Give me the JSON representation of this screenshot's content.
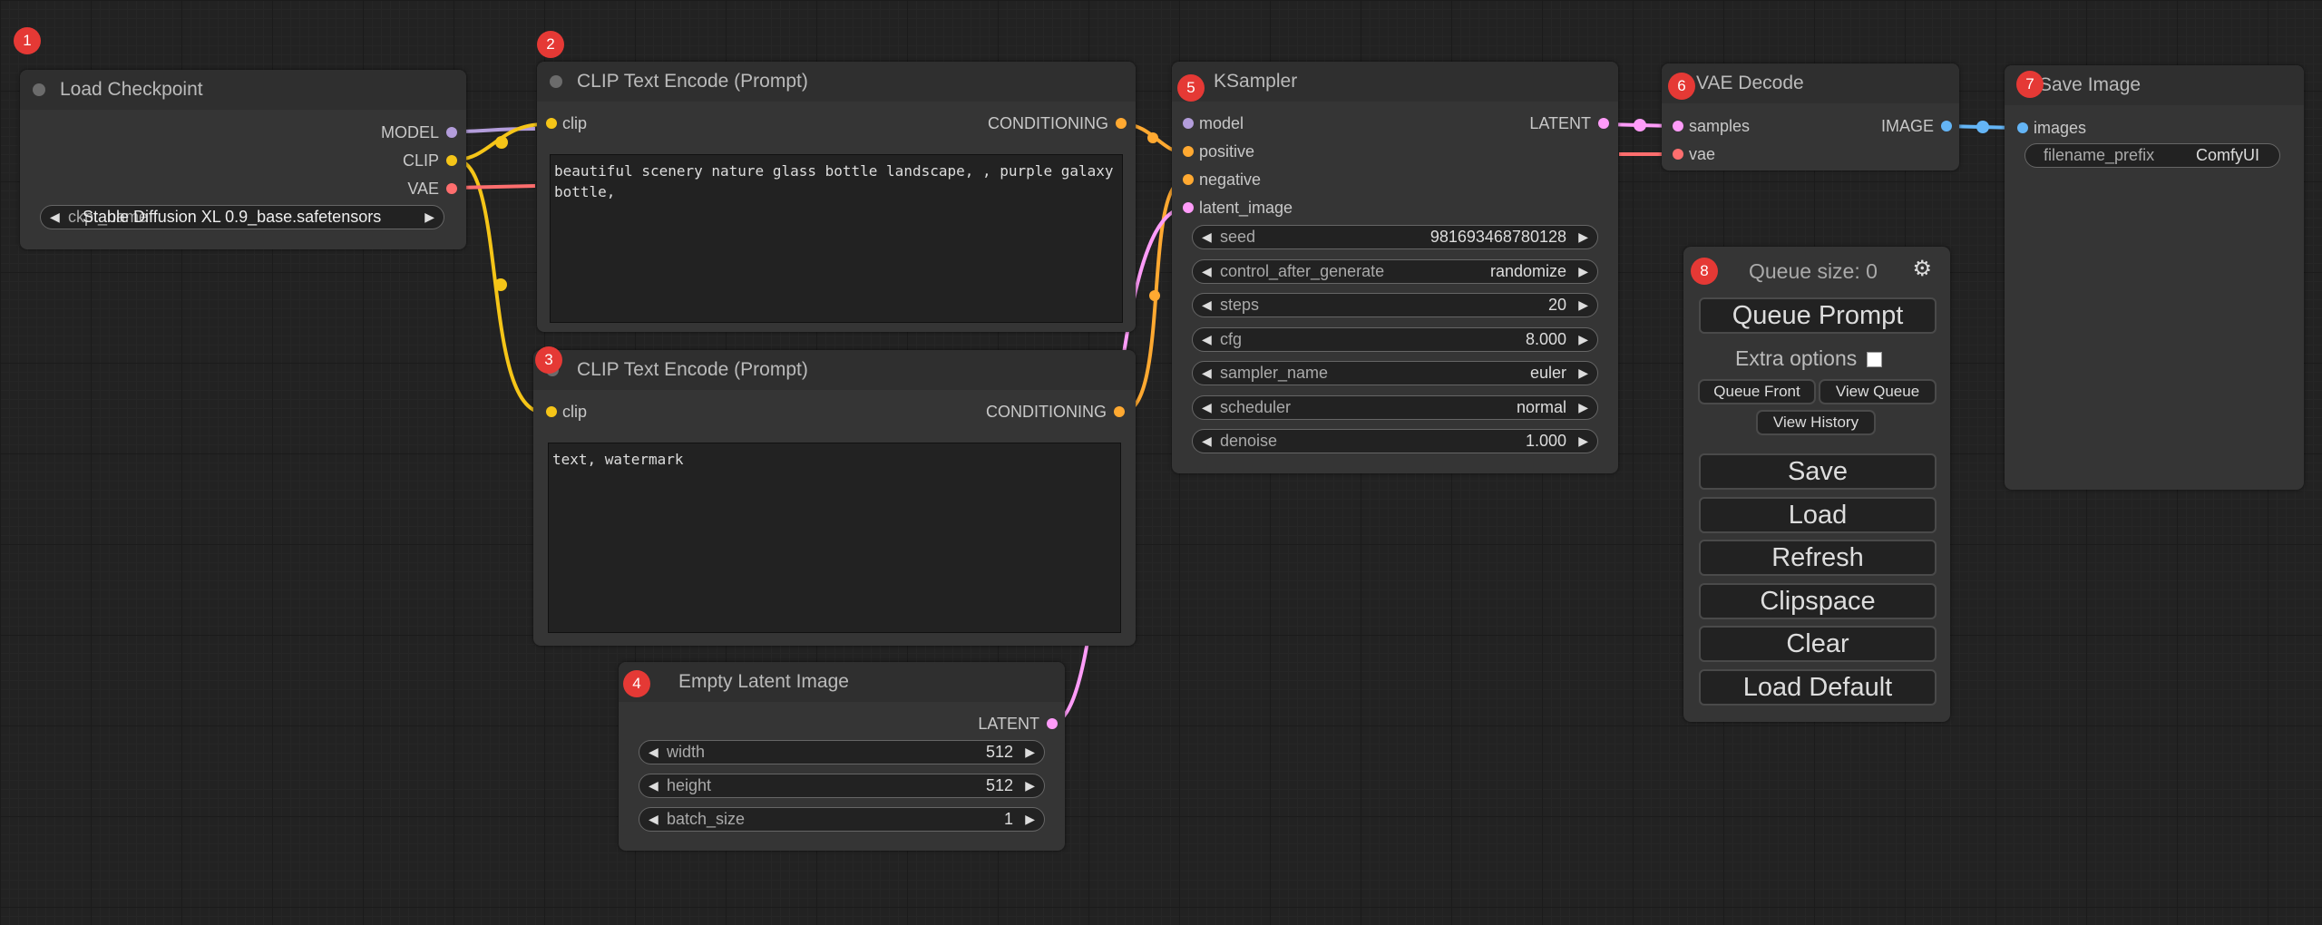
{
  "badges": [
    "1",
    "2",
    "3",
    "4",
    "5",
    "6",
    "7",
    "8"
  ],
  "nodes": {
    "load_checkpoint": {
      "title": "Load Checkpoint",
      "outputs": [
        "MODEL",
        "CLIP",
        "VAE"
      ],
      "ckpt_label": "ckpt_name",
      "ckpt_value": "Stable Diffusion XL 0.9_base.safetensors"
    },
    "clip_positive": {
      "title": "CLIP Text Encode (Prompt)",
      "input": "clip",
      "output": "CONDITIONING",
      "text": "beautiful scenery nature glass bottle landscape, , purple galaxy bottle,"
    },
    "clip_negative": {
      "title": "CLIP Text Encode (Prompt)",
      "input": "clip",
      "output": "CONDITIONING",
      "text": "text, watermark"
    },
    "empty_latent": {
      "title": "Empty Latent Image",
      "output": "LATENT",
      "widgets": [
        {
          "label": "width",
          "value": "512"
        },
        {
          "label": "height",
          "value": "512"
        },
        {
          "label": "batch_size",
          "value": "1"
        }
      ]
    },
    "ksampler": {
      "title": "KSampler",
      "inputs": [
        "model",
        "positive",
        "negative",
        "latent_image"
      ],
      "output": "LATENT",
      "widgets": [
        {
          "label": "seed",
          "value": "981693468780128"
        },
        {
          "label": "control_after_generate",
          "value": "randomize"
        },
        {
          "label": "steps",
          "value": "20"
        },
        {
          "label": "cfg",
          "value": "8.000"
        },
        {
          "label": "sampler_name",
          "value": "euler"
        },
        {
          "label": "scheduler",
          "value": "normal"
        },
        {
          "label": "denoise",
          "value": "1.000"
        }
      ]
    },
    "vae_decode": {
      "title": "VAE Decode",
      "inputs": [
        "samples",
        "vae"
      ],
      "output": "IMAGE"
    },
    "save_image": {
      "title": "Save Image",
      "input": "images",
      "prefix_label": "filename_prefix",
      "prefix_value": "ComfyUI"
    }
  },
  "queue_panel": {
    "queue_size": "Queue size: 0",
    "queue_prompt": "Queue Prompt",
    "extra_options": "Extra options",
    "queue_front": "Queue Front",
    "view_queue": "View Queue",
    "view_history": "View History",
    "save": "Save",
    "load": "Load",
    "refresh": "Refresh",
    "clipspace": "Clipspace",
    "clear": "Clear",
    "load_default": "Load Default",
    "settings_icon": "gear-icon"
  },
  "colors": {
    "model": "#b39ddb",
    "clip": "#f5c518",
    "vae": "#ff6e6e",
    "conditioning": "#ffa931",
    "latent": "#ff9cf9",
    "image": "#64b5f6",
    "badge": "#e53935"
  }
}
